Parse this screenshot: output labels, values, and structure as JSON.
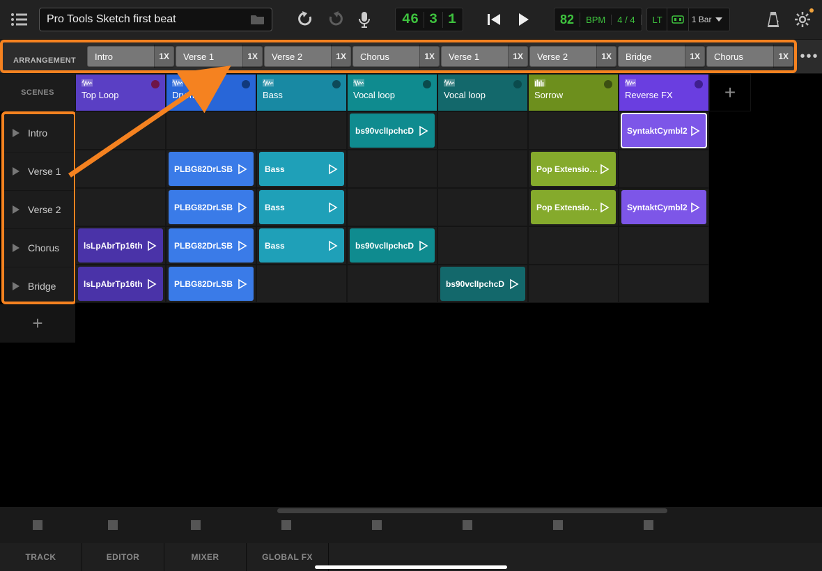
{
  "toolbar": {
    "project_title": "Pro Tools Sketch first beat",
    "counter": {
      "bars": "46",
      "beats": "3",
      "ticks": "1"
    },
    "bpm_value": "82",
    "bpm_label": "BPM",
    "time_sig": "4 / 4",
    "latency_label": "LT",
    "loop_length": "1 Bar"
  },
  "arrangement": {
    "label": "ARRANGEMENT",
    "segments": [
      {
        "name": "Intro",
        "mult": "1X"
      },
      {
        "name": "Verse 1",
        "mult": "1X"
      },
      {
        "name": "Verse 2",
        "mult": "1X"
      },
      {
        "name": "Chorus",
        "mult": "1X"
      },
      {
        "name": "Verse 1",
        "mult": "1X"
      },
      {
        "name": "Verse 2",
        "mult": "1X"
      },
      {
        "name": "Bridge",
        "mult": "1X"
      },
      {
        "name": "Chorus",
        "mult": "1X"
      }
    ]
  },
  "scenes": {
    "label": "SCENES",
    "items": [
      {
        "name": "Intro"
      },
      {
        "name": "Verse 1"
      },
      {
        "name": "Verse 2"
      },
      {
        "name": "Chorus"
      },
      {
        "name": "Bridge"
      }
    ]
  },
  "tracks": [
    {
      "name": "Top Loop",
      "color_head": "c-purple",
      "rec": "rec-purple",
      "type": "audio"
    },
    {
      "name": "Drum loop",
      "color_head": "c-blue",
      "rec": "rec-blue",
      "type": "audio"
    },
    {
      "name": "Bass",
      "color_head": "c-cyan",
      "rec": "rec-cyan",
      "type": "audio"
    },
    {
      "name": "Vocal loop",
      "color_head": "c-teal",
      "rec": "rec-teal",
      "type": "audio"
    },
    {
      "name": "Vocal loop",
      "color_head": "c-tealbg",
      "rec": "rec-teal",
      "type": "audio"
    },
    {
      "name": "Sorrow",
      "color_head": "c-green",
      "rec": "rec-green",
      "type": "midi"
    },
    {
      "name": "Reverse FX",
      "color_head": "c-violet",
      "rec": "rec-violet",
      "type": "audio"
    }
  ],
  "clips": {
    "row0": {
      "3": {
        "label": "bs90vclIpchcD",
        "color": "c-teal"
      },
      "6": {
        "label": "SyntaktCymbl2",
        "color": "c-violet-lt",
        "selected": true
      }
    },
    "row1": {
      "1": {
        "label": "PLBG82DrLSB",
        "color": "c-blue-lt"
      },
      "2": {
        "label": "Bass",
        "color": "c-cyan-lt"
      },
      "5": {
        "label": "Pop Extensions",
        "color": "c-green-lt"
      }
    },
    "row2": {
      "1": {
        "label": "PLBG82DrLSB",
        "color": "c-blue-lt"
      },
      "2": {
        "label": "Bass",
        "color": "c-cyan-lt"
      },
      "5": {
        "label": "Pop Extensions",
        "color": "c-green-lt"
      },
      "6": {
        "label": "SyntaktCymbl2",
        "color": "c-violet-lt"
      }
    },
    "row3": {
      "0": {
        "label": "lsLpAbrTp16th",
        "color": "c-purple-dk"
      },
      "1": {
        "label": "PLBG82DrLSB",
        "color": "c-blue-lt"
      },
      "2": {
        "label": "Bass",
        "color": "c-cyan-lt"
      },
      "3": {
        "label": "bs90vclIpchcD",
        "color": "c-teal"
      }
    },
    "row4": {
      "0": {
        "label": "lsLpAbrTp16th",
        "color": "c-purple-dk"
      },
      "1": {
        "label": "PLBG82DrLSB",
        "color": "c-blue-lt"
      },
      "4": {
        "label": "bs90vclIpchcD",
        "color": "c-tealbg"
      }
    }
  },
  "bottom_tabs": [
    "TRACK",
    "EDITOR",
    "MIXER",
    "GLOBAL FX"
  ]
}
